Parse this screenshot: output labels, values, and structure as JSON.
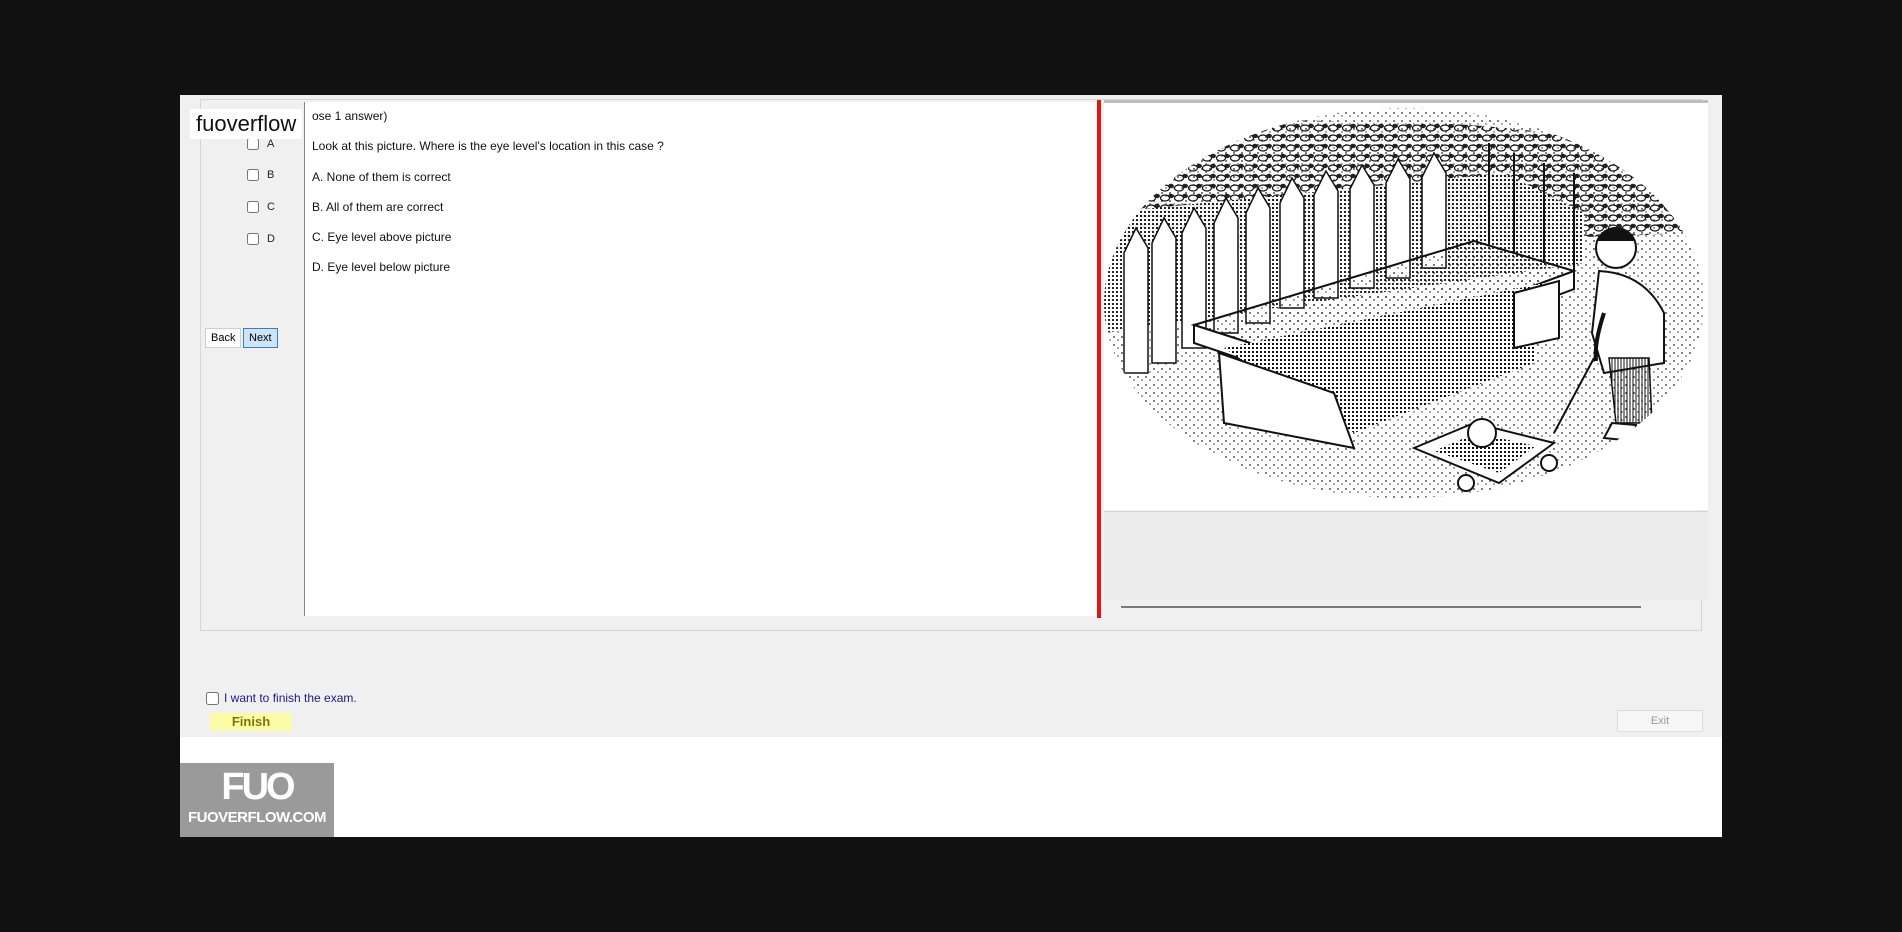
{
  "watermark": "fuoverflow",
  "answers": [
    {
      "label": "A"
    },
    {
      "label": "B"
    },
    {
      "label": "C"
    },
    {
      "label": "D"
    }
  ],
  "nav": {
    "back_label": "Back",
    "next_label": "Next"
  },
  "question": {
    "header": "ose 1 answer)",
    "text": "Look at this picture. Where is the eye level's location in this case ?",
    "options": [
      "A.  None of them is correct",
      "B.  All of them are correct",
      "C.  Eye level above picture",
      "D.  Eye level below picture"
    ]
  },
  "image": {
    "subject": "pen illustration of a table in a garden with fence and a child pulling a cart"
  },
  "finish": {
    "confirm_label": "I want to finish the exam.",
    "finish_label": "Finish",
    "exit_label": "Exit"
  },
  "logo": {
    "mark": "FUO",
    "site": "FUOVERFLOW.COM"
  },
  "colors": {
    "divider": "#e21515",
    "next_button": "#cce4f7",
    "finish_button": "#fbfba8"
  }
}
